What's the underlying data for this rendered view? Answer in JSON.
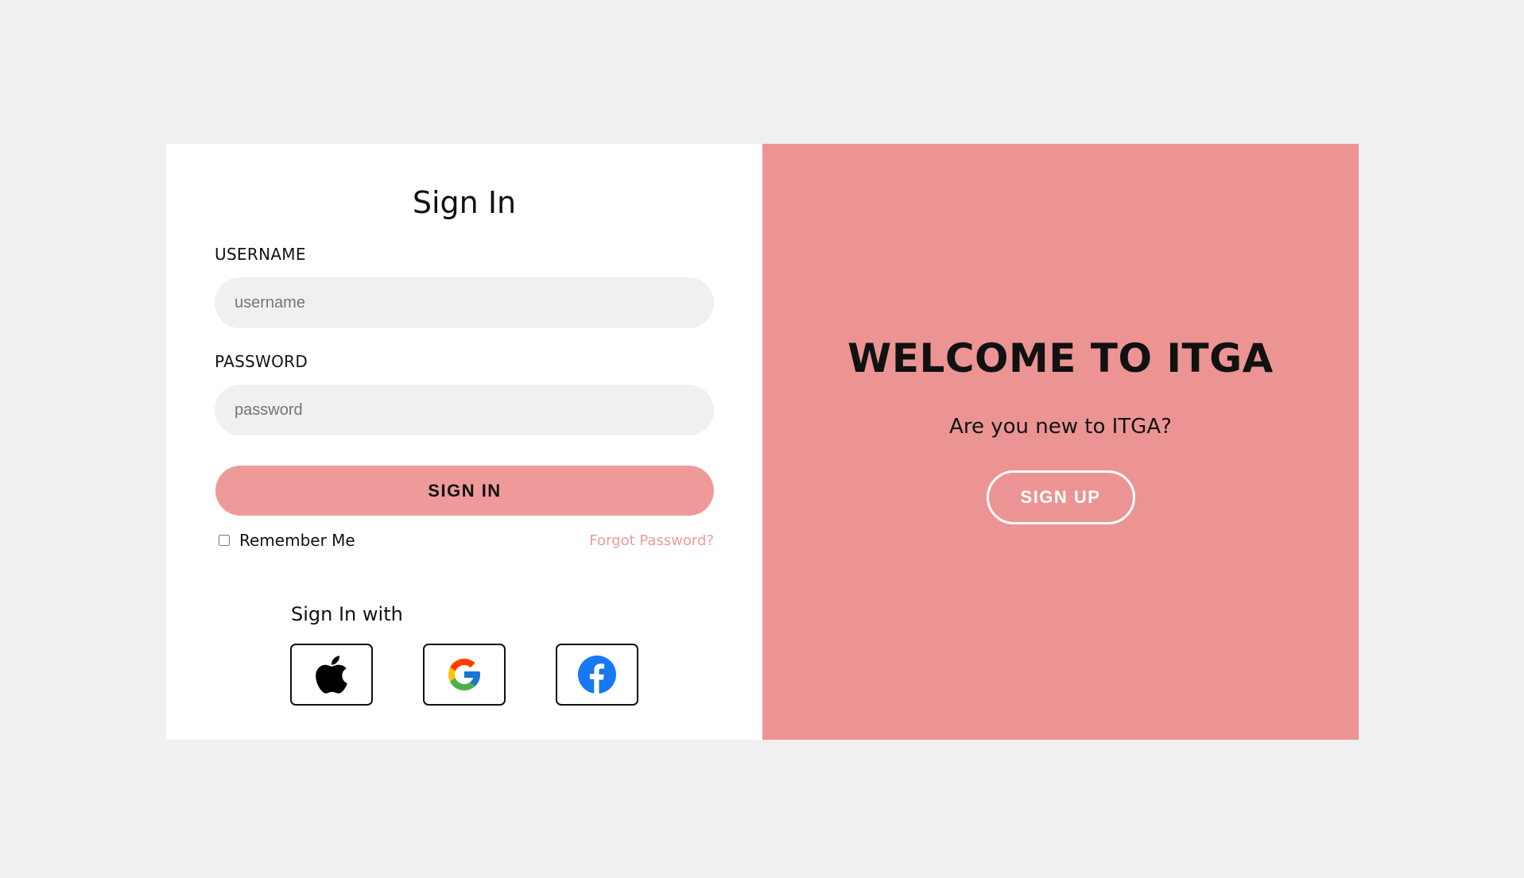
{
  "signin": {
    "title": "Sign In",
    "username_label": "USERNAME",
    "username_placeholder": "username",
    "username_value": "",
    "password_label": "PASSWORD",
    "password_placeholder": "password",
    "password_value": "",
    "submit_label": "SIGN IN",
    "remember_label": "Remember Me",
    "remember_checked": false,
    "forgot_label": "Forgot Password?",
    "social_title": "Sign In with",
    "social": [
      {
        "icon": "apple-icon"
      },
      {
        "icon": "google-icon"
      },
      {
        "icon": "facebook-icon"
      }
    ]
  },
  "welcome": {
    "title": "WELCOME TO ITGA",
    "subtitle": "Are you new to ITGA?",
    "signup_label": "SIGN UP"
  },
  "colors": {
    "page_bg": "#f0f0f0",
    "panel_pink": "#ec9494",
    "button_pink": "#ef9a9a",
    "input_bg": "#f0f0f0",
    "facebook_blue": "#1877f2"
  }
}
